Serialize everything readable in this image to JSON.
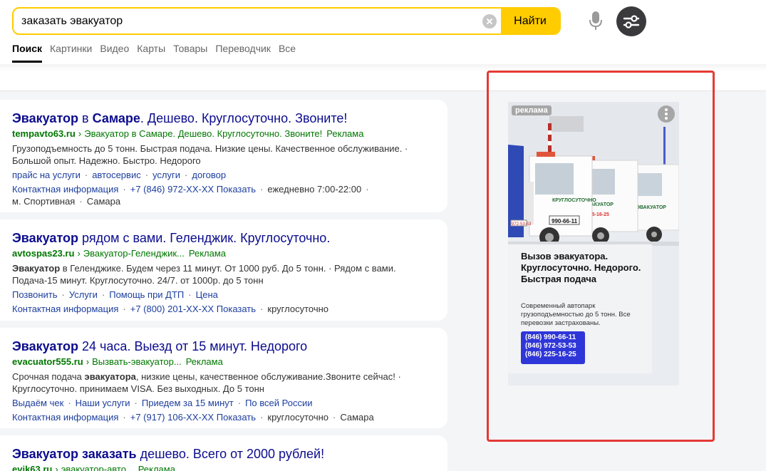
{
  "search": {
    "query": "заказать эвакуатор",
    "submit_label": "Найти"
  },
  "tabs": [
    "Поиск",
    "Картинки",
    "Видео",
    "Карты",
    "Товары",
    "Переводчик",
    "Все"
  ],
  "results": [
    {
      "title_parts": [
        {
          "text": "Эвакуатор",
          "bold": true
        },
        {
          "text": " в ",
          "bold": false
        },
        {
          "text": "Самаре",
          "bold": true
        },
        {
          "text": ". Дешево. Круглосуточно. Звоните!",
          "bold": false
        }
      ],
      "domain": "tempavto63.ru",
      "crumb": "Эвакуатор в Самаре. Дешево. Круглосуточно. Звоните!",
      "ad_label": "Реклама",
      "description": "Грузоподъемность до 5 тонн. Быстрая подача. Низкие цены. Качественное обслуживание. · Большой опыт. Надежно. Быстро. Недорого",
      "sitelinks": [
        "прайс на услуги",
        "автосервис",
        "услуги",
        "договор"
      ],
      "contacts": [
        {
          "text": "Контактная информация",
          "link": true
        },
        {
          "text": "+7 (846) 972-XX-XX Показать",
          "link": true
        },
        {
          "text": "ежедневно 7:00-22:00",
          "link": false
        },
        {
          "text": "м. Спортивная",
          "link": false
        },
        {
          "text": "Самара",
          "link": false
        }
      ]
    },
    {
      "title_parts": [
        {
          "text": "Эвакуатор",
          "bold": true
        },
        {
          "text": " рядом с вами. Геленджик. Круглосуточно.",
          "bold": false
        }
      ],
      "domain": "avtospas23.ru",
      "crumb": "Эвакуатор-Геленджик...",
      "ad_label": "Реклама",
      "description_html": "<b>Эвакуатор</b> в Геленджике. Будем через 11 минут. От 1000 руб. До 5 тонн. · Рядом с вами. Подача-15 минут. Круглосуточно. 24/7. от 1000р. до 5 тонн",
      "sitelinks": [
        "Позвонить",
        "Услуги",
        "Помощь при ДТП",
        "Цена"
      ],
      "contacts": [
        {
          "text": "Контактная информация",
          "link": true
        },
        {
          "text": "+7 (800) 201-XX-XX Показать",
          "link": true
        },
        {
          "text": "круглосуточно",
          "link": false
        }
      ]
    },
    {
      "title_parts": [
        {
          "text": "Эвакуатор",
          "bold": true
        },
        {
          "text": " 24 часа. Выезд от 15 минут. Недорого",
          "bold": false
        }
      ],
      "domain": "evacuator555.ru",
      "crumb": "Вызвать-эвакуатор...",
      "ad_label": "Реклама",
      "description_html": "Срочная подача <b>эвакуатора</b>, низкие цены, качественное обслуживание.Звоните сейчас! · Круглосуточно. принимаем VISA. Без выходных. До 5 тонн",
      "sitelinks": [
        "Выдаём чек",
        "Наши услуги",
        "Приедем за 15 минут",
        "По всей России"
      ],
      "contacts": [
        {
          "text": "Контактная информация",
          "link": true
        },
        {
          "text": "+7 (917) 106-XX-XX Показать",
          "link": true
        },
        {
          "text": "круглосуточно",
          "link": false
        },
        {
          "text": "Самара",
          "link": false
        }
      ]
    },
    {
      "title_parts": [
        {
          "text": "Эвакуатор заказать",
          "bold": true
        },
        {
          "text": " дешево. Всего от 2000 рублей!",
          "bold": false
        }
      ],
      "domain": "evik63.ru",
      "crumb": "эвакуатор-авто...",
      "ad_label": "Реклама"
    }
  ],
  "side_ad": {
    "label": "реклама",
    "heading": "Вызов эвакуатора. Круглосуточно. Недорого. Быстрая подача",
    "subtext": "Современный автопарк грузоподъемностью до 5 тонн. Все перевозки застрахованы.",
    "phones": [
      "(846) 990-66-11",
      "(846) 972-53-53",
      "(846) 225-16-25"
    ],
    "truck_text_1": "ЭВАКУАТОР",
    "truck_text_2": "КРУГЛОСУТОЧНО",
    "truck_phone": "990-66-11",
    "truck_phone_2": "972-53-53",
    "truck_phone_3": "225-16-25",
    "highlight_color": "#e53935"
  }
}
